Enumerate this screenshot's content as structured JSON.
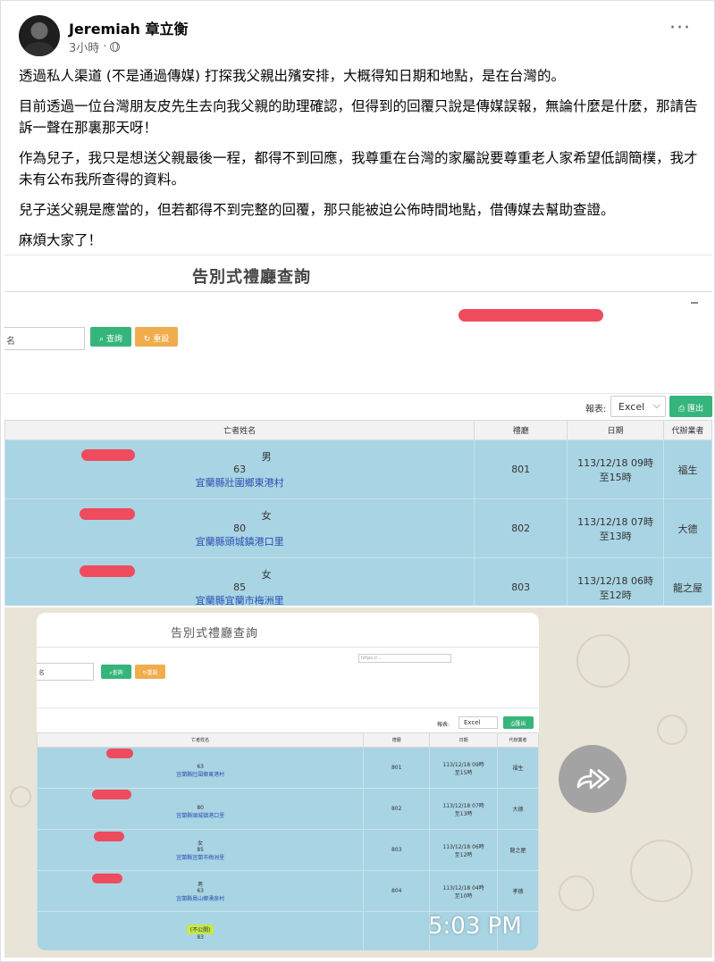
{
  "post": {
    "author": "Jeremiah 章立衡",
    "time": "3小時",
    "privacy_icon": "globe-icon",
    "more_icon": "more-options-icon",
    "paragraphs": [
      "透過私人渠道 (不是通過傳媒) 打探我父親出殯安排，大概得知日期和地點，是在台灣的。",
      "目前透過一位台灣朋友皮先生去向我父親的助理確認，但得到的回覆只說是傳媒誤報，無論什麼是什麼，那請告訴一聲在那裏那天呀！",
      "作為兒子，我只是想送父親最後一程，都得不到回應，我尊重在台灣的家屬說要尊重老人家希望低調簡樸，我才未有公布我所查得的資料。",
      "兒子送父親是應當的，但若都得不到完整的回覆，那只能被迫公佈時間地點，借傳媒去幫助查證。",
      "麻煩大家了！"
    ]
  },
  "screenshot1": {
    "title": "告別式禮廳查詢",
    "name_placeholder": "名",
    "search_label": "查詢",
    "reset_label": "重設",
    "export_label": "報表:",
    "export_format": "Excel",
    "export_button": "匯出",
    "headers": [
      "亡者姓名",
      "禮廳",
      "日期",
      "代辦業者"
    ],
    "rows": [
      {
        "sex": "男",
        "age": "63",
        "address": "宜蘭縣壯圍鄉東港村",
        "hall": "801",
        "date": "113/12/18 09時",
        "until": "至15時",
        "agent": "福生"
      },
      {
        "sex": "女",
        "age": "80",
        "address": "宜蘭縣頭城鎮港口里",
        "hall": "802",
        "date": "113/12/18 07時",
        "until": "至13時",
        "agent": "大德"
      },
      {
        "sex": "女",
        "age": "85",
        "address": "宜蘭縣宜蘭市梅洲里",
        "hall": "803",
        "date": "113/12/18 06時",
        "until": "至12時",
        "agent": "龍之屋"
      }
    ]
  },
  "screenshot2": {
    "title": "告別式禮廳查詢",
    "name_placeholder": "名",
    "search_label": "查詢",
    "reset_label": "重設",
    "export_label": "報表:",
    "export_format": "Excel",
    "export_button": "匯出",
    "headers": [
      "亡者姓名",
      "禮廳",
      "日期",
      "代辦業者"
    ],
    "rows": [
      {
        "sex": "",
        "age": "63",
        "address": "宜蘭縣壯圍鄉東港村",
        "hall": "801",
        "date": "113/12/18 09時",
        "until": "至15時",
        "agent": "福生"
      },
      {
        "sex": "",
        "age": "80",
        "address": "宜蘭縣頭城鎮港口里",
        "hall": "802",
        "date": "113/12/18 07時",
        "until": "至13時",
        "agent": "大德"
      },
      {
        "sex": "女",
        "age": "85",
        "address": "宜蘭縣宜蘭市梅洲里",
        "hall": "803",
        "date": "113/12/18 06時",
        "until": "至12時",
        "agent": "龍之屋"
      },
      {
        "sex": "男",
        "age": "63",
        "address": "宜蘭縣員山鄉湧泉村",
        "hall": "804",
        "date": "113/12/18 04時",
        "until": "至10時",
        "agent": "孝德"
      }
    ],
    "highlight": "(不公開)",
    "highlight_age": "83",
    "timestamp": "5:03 PM",
    "forward_icon": "forward-icon"
  }
}
